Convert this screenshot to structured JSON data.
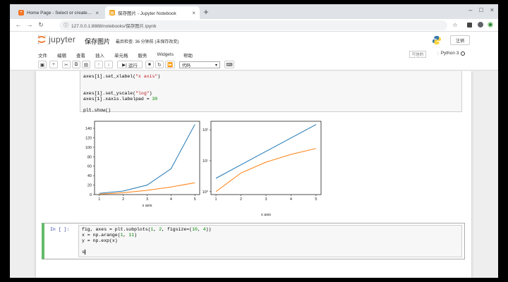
{
  "browser": {
    "tabs": [
      {
        "title": "Home Page - Select or create a notebook",
        "active": false,
        "icon": "jupyter-favicon-icon"
      },
      {
        "title": "保存图片 - Jupyter Notebook",
        "active": true,
        "icon": "notebook-favicon-icon"
      }
    ],
    "new_tab_label": "+",
    "url": "127.0.0.1:8888/notebooks/保存图片.ipynb"
  },
  "jupyter": {
    "logo_text": "jupyter",
    "notebook_name": "保存图片",
    "checkpoint": "最后检查: 36 分钟前   (未保存改变)",
    "logout_label": "注销",
    "menu": [
      "文件",
      "编辑",
      "查看",
      "插入",
      "单元格",
      "服务",
      "Widgets",
      "帮助"
    ],
    "trusted_label": "可信的",
    "kernel_name": "Python 3",
    "toolbar": {
      "run_label": "运行",
      "cell_type": "代码"
    },
    "accent": "#f37626"
  },
  "cells": [
    {
      "prompt": "",
      "lines": [
        [
          "axes[1].set_xlabel(",
          {
            "s": "\"x axis\""
          },
          ")"
        ],
        [
          ""
        ],
        [
          ""
        ],
        [
          "axes[1].set_yscale(",
          {
            "s": "\"log\""
          },
          ")"
        ],
        [
          "axes[1].xaxis.labelpad = ",
          {
            "n": "30"
          }
        ],
        [
          ""
        ],
        [
          "plt.show()"
        ]
      ]
    },
    {
      "prompt": "In [ ]:",
      "lines": [
        [
          "fig, axes = plt.subplots(",
          {
            "n": "1"
          },
          ", ",
          {
            "n": "2"
          },
          ", figsize=(",
          {
            "n": "10"
          },
          ", ",
          {
            "n": "4"
          },
          "))"
        ],
        [
          "x = np.arange(",
          {
            "n": "1"
          },
          ", ",
          {
            "n": "11"
          },
          ")"
        ],
        [
          "y = np.exp(x)"
        ],
        [
          ""
        ],
        [
          "s"
        ]
      ]
    }
  ],
  "chart_data": [
    {
      "type": "line",
      "x": [
        1,
        2,
        3,
        4,
        5
      ],
      "series": [
        {
          "values": [
            2.7,
            7.4,
            20.1,
            54.6,
            148.4
          ],
          "color": "#1f77b4"
        },
        {
          "values": [
            1,
            4,
            9,
            16,
            25
          ],
          "color": "#ff7f0e"
        }
      ],
      "xticks": [
        "1",
        "2",
        "3",
        "4",
        "5"
      ],
      "yticks": [
        "0",
        "20",
        "40",
        "60",
        "80",
        "100",
        "120",
        "140"
      ],
      "ylim": [
        0,
        155
      ],
      "xlabel": "x axis",
      "grid": false
    },
    {
      "type": "line",
      "x": [
        1,
        2,
        3,
        4,
        5
      ],
      "series": [
        {
          "values": [
            2.7,
            7.4,
            20.1,
            54.6,
            148.4
          ],
          "color": "#1f77b4"
        },
        {
          "values": [
            1,
            4,
            9,
            16,
            25
          ],
          "color": "#ff7f0e"
        }
      ],
      "yscale": "log",
      "xticks": [
        "1",
        "2",
        "3",
        "4",
        "5"
      ],
      "yticks": [
        "10⁰",
        "10¹",
        "10²"
      ],
      "xlabel": "x axis",
      "grid": false
    }
  ]
}
